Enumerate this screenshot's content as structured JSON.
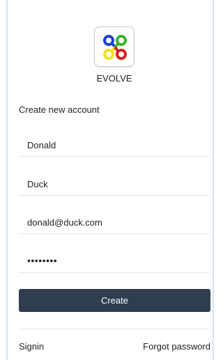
{
  "brand": {
    "name": "EVOLVE",
    "icon": "evolve-logo-icon",
    "logo_colors": [
      "#1f3fd1",
      "#3bb32d",
      "#f2e21b",
      "#d71f1f"
    ]
  },
  "form": {
    "title": "Create new account",
    "fields": [
      {
        "name": "first-name",
        "value": "Donald"
      },
      {
        "name": "last-name",
        "value": "Duck"
      },
      {
        "name": "email",
        "value": "donald@duck.com"
      },
      {
        "name": "password",
        "value": "••••••••"
      }
    ],
    "submit_label": "Create"
  },
  "links": {
    "signin": "Signin",
    "forgot_password": "Forgot password"
  },
  "colors": {
    "button_bg": "#2f3d4e",
    "button_text": "#ffffff",
    "frame_border": "#d7e3ee"
  }
}
